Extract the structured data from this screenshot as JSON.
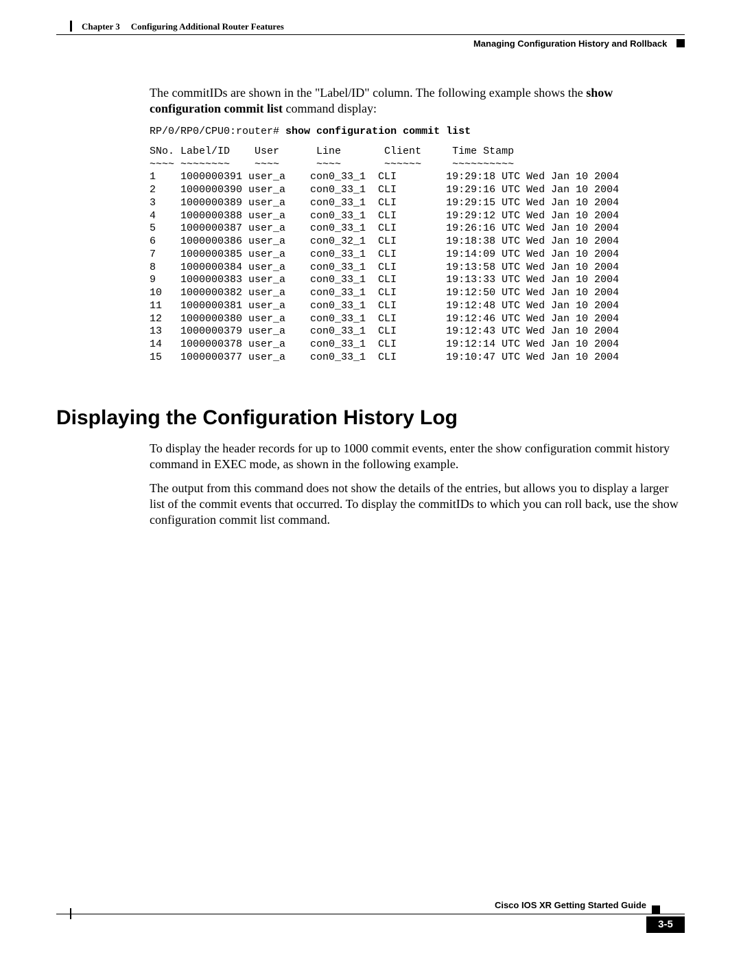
{
  "header": {
    "chapter_label": "Chapter 3",
    "chapter_title": "Configuring Additional Router Features",
    "section_title": "Managing Configuration History and Rollback"
  },
  "intro": {
    "para1_pre": "The commitIDs are shown in the \"Label/ID\" column. The following example shows the ",
    "para1_bold": "show configuration commit list",
    "para1_post": " command display:",
    "prompt": "RP/0/RP0/CPU0:router# ",
    "command": "show configuration commit list"
  },
  "commit_list": {
    "header": "SNo. Label/ID    User      Line       Client     Time Stamp",
    "sep": "~~~~ ~~~~~~~~    ~~~~      ~~~~       ~~~~~~     ~~~~~~~~~~",
    "rows": [
      "1    1000000391 user_a    con0_33_1  CLI        19:29:18 UTC Wed Jan 10 2004",
      "2    1000000390 user_a    con0_33_1  CLI        19:29:16 UTC Wed Jan 10 2004",
      "3    1000000389 user_a    con0_33_1  CLI        19:29:15 UTC Wed Jan 10 2004",
      "4    1000000388 user_a    con0_33_1  CLI        19:29:12 UTC Wed Jan 10 2004",
      "5    1000000387 user_a    con0_33_1  CLI        19:26:16 UTC Wed Jan 10 2004",
      "6    1000000386 user_a    con0_32_1  CLI        19:18:38 UTC Wed Jan 10 2004",
      "7    1000000385 user_a    con0_33_1  CLI        19:14:09 UTC Wed Jan 10 2004",
      "8    1000000384 user_a    con0_33_1  CLI        19:13:58 UTC Wed Jan 10 2004",
      "9    1000000383 user_a    con0_33_1  CLI        19:13:33 UTC Wed Jan 10 2004",
      "10   1000000382 user_a    con0_33_1  CLI        19:12:50 UTC Wed Jan 10 2004",
      "11   1000000381 user_a    con0_33_1  CLI        19:12:48 UTC Wed Jan 10 2004",
      "12   1000000380 user_a    con0_33_1  CLI        19:12:46 UTC Wed Jan 10 2004",
      "13   1000000379 user_a    con0_33_1  CLI        19:12:43 UTC Wed Jan 10 2004",
      "14   1000000378 user_a    con0_33_1  CLI        19:12:14 UTC Wed Jan 10 2004",
      "15   1000000377 user_a    con0_33_1  CLI        19:10:47 UTC Wed Jan 10 2004"
    ]
  },
  "section2": {
    "heading": "Displaying the Configuration History Log",
    "p1_pre": "To display the header records for up to 1000 commit events, enter the ",
    "p1_bold": "show configuration commit history",
    "p1_post": " command in EXEC mode, as shown in the following example.",
    "p2_pre": "The output from this command does not show the details of the entries, but allows you to display a larger list of the commit events that occurred. To display the commitIDs to which you can roll back, use the ",
    "p2_bold": "show configuration commit list",
    "p2_post": " command."
  },
  "footer": {
    "book_title": "Cisco IOS XR Getting Started Guide",
    "page_number": "3-5"
  }
}
